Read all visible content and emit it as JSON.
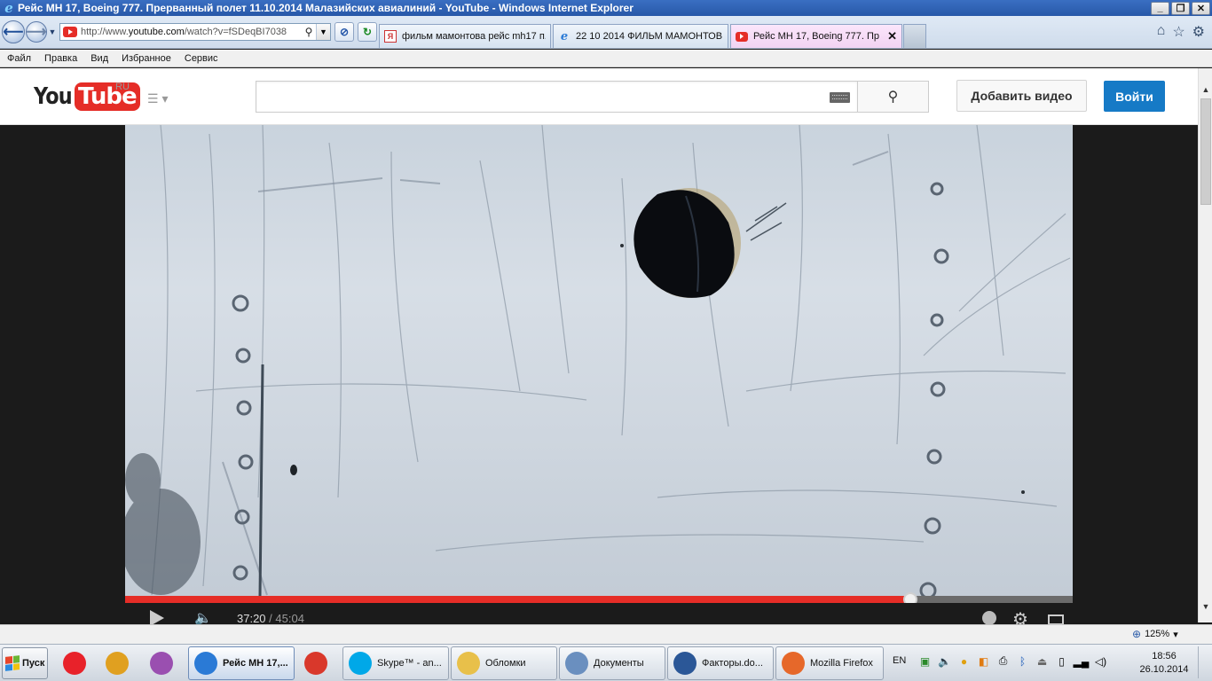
{
  "window": {
    "title": "Рейс МН 17, Boeing 777. Прерванный полет 11.10.2014 Малазийских авиалиний - YouTube - Windows Internet Explorer",
    "buttons": {
      "minimize": "_",
      "maximize": "❐",
      "close": "✕"
    }
  },
  "navigation": {
    "url_prefix": "http://www.",
    "url_host": "youtube.com",
    "url_path": "/watch?v=fSDeqBI7038",
    "tabs": [
      {
        "label": "фильм мамонтова рейс mh17 п...",
        "icon": "yandex-icon",
        "active": false,
        "closable": false
      },
      {
        "label": "22 10 2014 ФИЛЬМ МАМОНТОВ...",
        "icon": "ie-icon",
        "active": false,
        "closable": false
      },
      {
        "label": "Рейс МН 17, Boeing 777. Пр...",
        "icon": "youtube-icon",
        "active": true,
        "closable": true
      }
    ],
    "close_tab_label": "✕"
  },
  "menu": {
    "items": [
      "Файл",
      "Правка",
      "Вид",
      "Избранное",
      "Сервис"
    ]
  },
  "youtube": {
    "logo_you": "You",
    "logo_tube": "Tube",
    "region": "RU",
    "search_placeholder": "",
    "upload_label": "Добавить видео",
    "signin_label": "Войти"
  },
  "player": {
    "current_time": "37:20",
    "separator": " / ",
    "duration": "45:04",
    "progress_fraction": 0.8283,
    "colors": {
      "progress": "#e52d27",
      "background": "#1b1b1b"
    }
  },
  "statusbar": {
    "zoom_label": "125%"
  },
  "taskbar": {
    "start_label": "Пуск",
    "items": [
      {
        "label": "",
        "icon": "yandex-browser-icon",
        "color": "#e8222a",
        "icon_only": true
      },
      {
        "label": "",
        "icon": "paint-icon",
        "color": "#e0a020",
        "icon_only": true
      },
      {
        "label": "",
        "icon": "opera-like-icon",
        "color": "#9a4fb0",
        "icon_only": true
      },
      {
        "label": "Рейс МН 17,...",
        "icon": "ie-icon",
        "color": "#2a7ad6",
        "active": true
      },
      {
        "label": "",
        "icon": "chrome-icon",
        "color": "#d9382b",
        "icon_only": true
      },
      {
        "label": "Skype™ - an...",
        "icon": "skype-icon",
        "color": "#00a8e8"
      },
      {
        "label": "Обломки",
        "icon": "folder-icon",
        "color": "#e8c04a"
      },
      {
        "label": "Документы",
        "icon": "documents-icon",
        "color": "#6a8fbf"
      },
      {
        "label": "Факторы.do...",
        "icon": "word-icon",
        "color": "#2b5797"
      },
      {
        "label": "Mozilla Firefox",
        "icon": "firefox-icon",
        "color": "#e6682a"
      }
    ],
    "language": "EN",
    "clock_time": "18:56",
    "clock_date": "26.10.2014"
  }
}
